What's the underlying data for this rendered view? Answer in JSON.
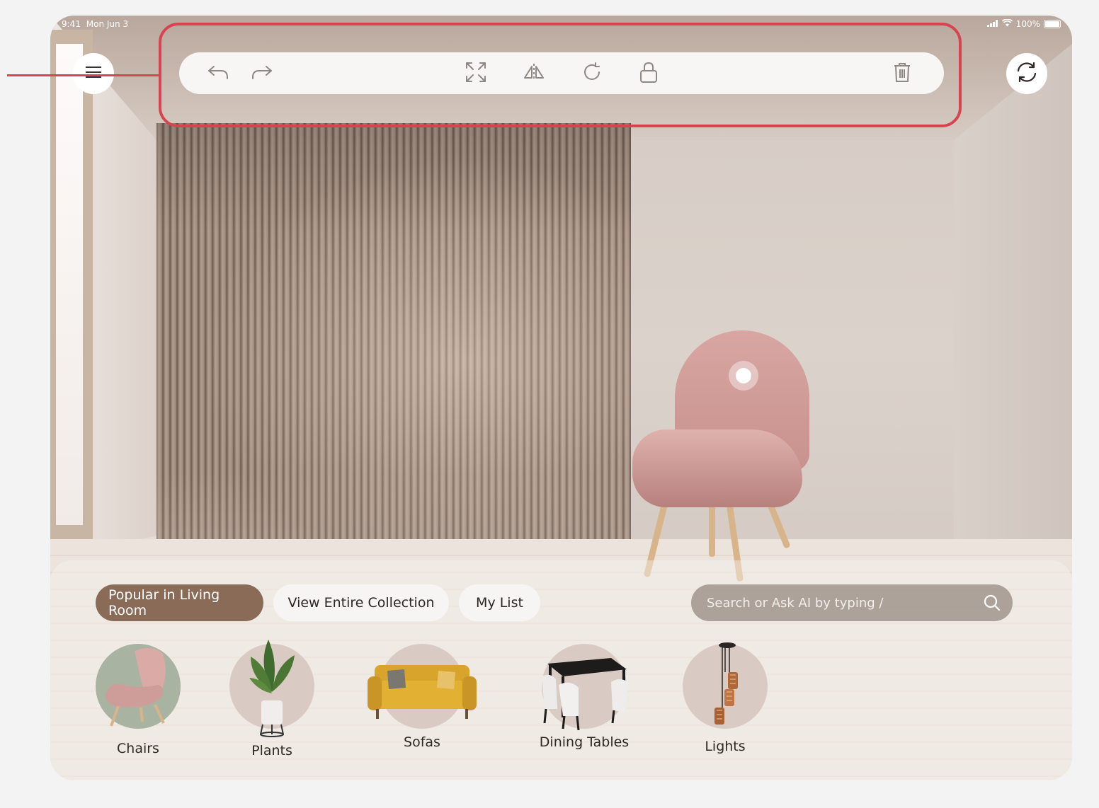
{
  "status_bar": {
    "time": "9:41",
    "date": "Mon Jun 3",
    "battery": "100%"
  },
  "toolbar": {
    "menu_icon": "hamburger-menu-icon",
    "undo_icon": "undo-icon",
    "redo_icon": "redo-icon",
    "resize_icon": "expand-arrows-icon",
    "flip_icon": "flip-horizontal-icon",
    "rotate_icon": "rotate-icon",
    "lock_icon": "lock-icon",
    "delete_icon": "trash-icon",
    "refresh_icon": "refresh-icon"
  },
  "tabs": [
    {
      "label": "Popular in Living Room",
      "active": true
    },
    {
      "label": "View Entire Collection",
      "active": false
    },
    {
      "label": "My List",
      "active": false
    }
  ],
  "search": {
    "placeholder": "Search or Ask AI by typing /"
  },
  "categories": [
    {
      "label": "Chairs"
    },
    {
      "label": "Plants"
    },
    {
      "label": "Sofas"
    },
    {
      "label": "Dining Tables"
    },
    {
      "label": "Lights"
    }
  ],
  "colors": {
    "accent": "#8a6b58",
    "highlight": "#d6454f",
    "chair": "#d2a19d"
  }
}
